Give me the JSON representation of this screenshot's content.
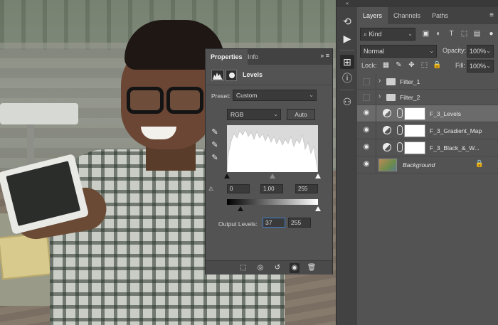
{
  "panels": {
    "collapse_glyph": "«",
    "layers_tab": "Layers",
    "channels_tab": "Channels",
    "paths_tab": "Paths",
    "panel_menu_glyph": "≡"
  },
  "layers_toolbar": {
    "kind_label": "Kind",
    "blend_mode": "Normal",
    "opacity_label": "Opacity:",
    "opacity_value": "100%",
    "lock_label": "Lock:",
    "fill_label": "Fill:",
    "fill_value": "100%"
  },
  "layers": [
    {
      "name": "Filter_1",
      "type": "group",
      "visible": false
    },
    {
      "name": "Filter_2",
      "type": "group",
      "visible": false
    },
    {
      "name": "F_3_Levels",
      "type": "adjustment",
      "visible": true,
      "selected": true
    },
    {
      "name": "F_3_Gradient_Map",
      "type": "adjustment",
      "visible": true
    },
    {
      "name": "F_3_Black_&_W...",
      "type": "adjustment",
      "visible": true
    },
    {
      "name": "Background",
      "type": "image",
      "visible": true,
      "locked": true
    }
  ],
  "properties": {
    "tab_properties": "Properties",
    "tab_info": "Info",
    "menu_glyph": "»  ≡",
    "title": "Levels",
    "preset_label": "Preset:",
    "preset_value": "Custom",
    "channel_value": "RGB",
    "auto_label": "Auto",
    "input_black": "0",
    "input_mid": "1,00",
    "input_white": "255",
    "output_label": "Output Levels:",
    "output_black": "37",
    "output_white": "255"
  },
  "icons": {
    "collapse": "chevron-double-left-icon",
    "history": "history-icon",
    "play": "play-icon",
    "adjustments": "adjustments-icon",
    "info": "info-icon",
    "people": "people-icon"
  },
  "colors": {
    "panel_bg": "#535353",
    "panel_dark": "#424242",
    "selected_row": "#6b6b6b",
    "focus_blue": "#3d7bc6"
  }
}
